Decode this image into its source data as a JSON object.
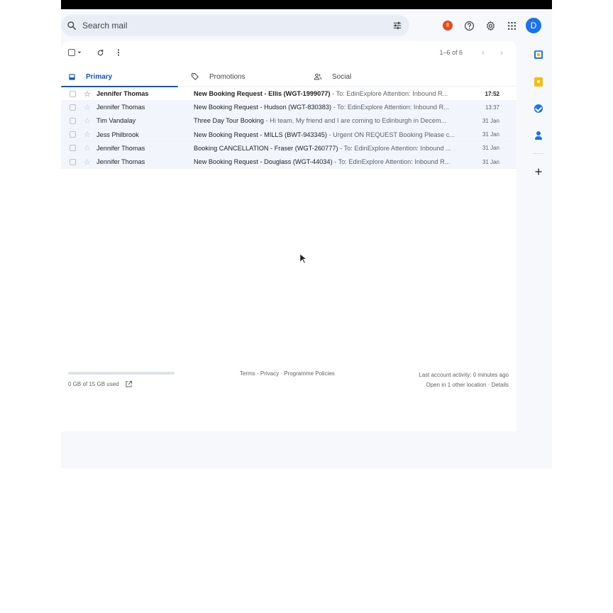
{
  "search": {
    "placeholder": "Search mail"
  },
  "header": {
    "avatar_letter": "D"
  },
  "toolbar": {
    "pager_text": "1–6 of 6"
  },
  "tabs": [
    {
      "label": "Primary",
      "active": true
    },
    {
      "label": "Promotions",
      "active": false
    },
    {
      "label": "Social",
      "active": false
    }
  ],
  "emails": [
    {
      "sender": "Jennifer Thomas",
      "subject": "New Booking Request - Ellis (WGT-1999077)",
      "snippet": " - To: EdinExplore Attention: Inbound R...",
      "date": "17:52",
      "unread": true
    },
    {
      "sender": "Jennifer Thomas",
      "subject": "New Booking Request - Hudson (WGT-830383)",
      "snippet": " - To: EdinExplore Attention: Inbound R...",
      "date": "13:37",
      "unread": false
    },
    {
      "sender": "Tim Vandalay",
      "subject": "Three Day Tour Booking",
      "snippet": " - Hi team, My friend and I are coming to Edinburgh in Decem...",
      "date": "31 Jan",
      "unread": false
    },
    {
      "sender": "Jess Philbrook",
      "subject": "New Booking Request - MILLS (BWT-943345)",
      "snippet": " - Urgent ON REQUEST Booking Please c...",
      "date": "31 Jan",
      "unread": false
    },
    {
      "sender": "Jennifer Thomas",
      "subject": "Booking CANCELLATION - Fraser (WGT-260777)",
      "snippet": " - To: EdinExplore Attention: Inbound ...",
      "date": "31 Jan",
      "unread": false
    },
    {
      "sender": "Jennifer Thomas",
      "subject": "New Booking Request - Douglass (WGT-44034)",
      "snippet": " - To: EdinExplore Attention: Inbound R...",
      "date": "31 Jan",
      "unread": false
    }
  ],
  "footer": {
    "storage_text": "0 GB of 15 GB used",
    "storage_fraction": 0.0,
    "links": "Terms · Privacy · Programme Policies",
    "activity_line1": "Last account activity: 0 minutes ago",
    "activity_line2": "Open in 1 other location · Details"
  },
  "colors": {
    "accent": "#0b57d0",
    "avatar": "#1a73e8",
    "read_row": "#f2f6fc"
  },
  "icons": [
    "search-icon",
    "tune-icon",
    "gemini-icon",
    "help-icon",
    "settings-icon",
    "apps-icon",
    "inbox-icon",
    "tag-icon",
    "people-icon",
    "calendar-icon",
    "keep-icon",
    "tasks-icon",
    "contacts-icon",
    "plus-icon",
    "refresh-icon",
    "more-vert-icon",
    "external-link-icon",
    "chevron-left-icon",
    "chevron-right-icon",
    "cursor-icon"
  ]
}
